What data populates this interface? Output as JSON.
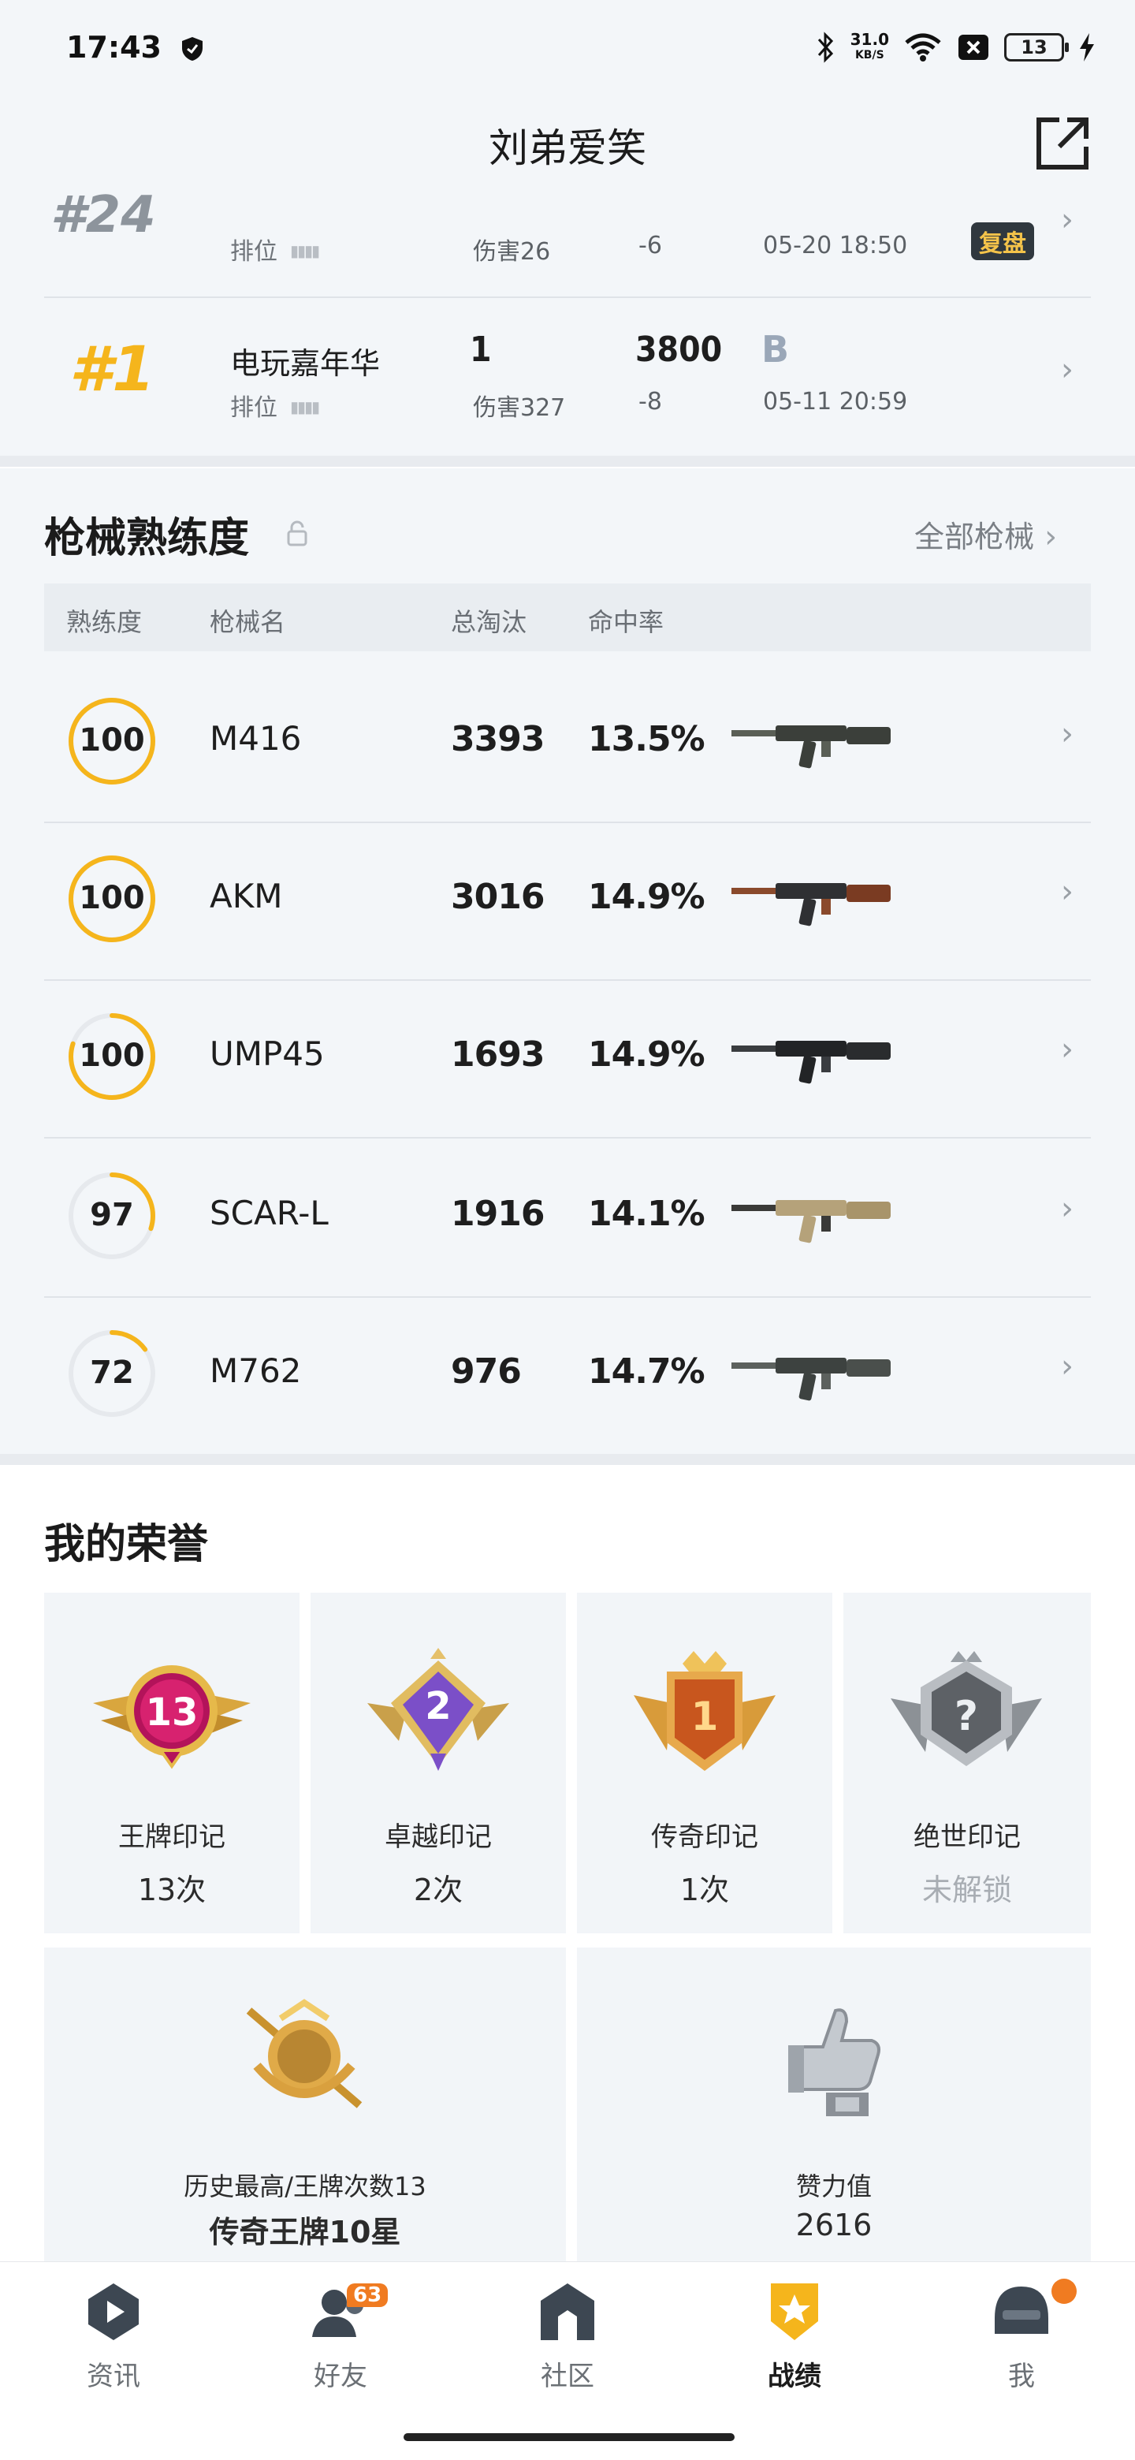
{
  "status_bar": {
    "time": "17:43",
    "net_speed": "31.0",
    "net_unit": "KB/S",
    "battery": "13"
  },
  "header": {
    "title": "刘弟爱笑"
  },
  "matches": [
    {
      "rank": "#24",
      "mode": "",
      "type": "排位",
      "kills": "",
      "score": "",
      "grade": "",
      "damage": "伤害26",
      "change": "-6",
      "time": "05-20 18:50",
      "replay": "复盘"
    },
    {
      "rank": "#1",
      "mode": "电玩嘉年华",
      "type": "排位",
      "kills": "1",
      "score": "3800",
      "grade": "B",
      "damage": "伤害327",
      "change": "-8",
      "time": "05-11 20:59",
      "replay": ""
    }
  ],
  "weapons": {
    "title": "枪械熟练度",
    "all_link": "全部枪械",
    "headers": [
      "熟练度",
      "枪械名",
      "总淘汰",
      "命中率"
    ],
    "rows": [
      {
        "level": "100",
        "progress": 1.0,
        "name": "M416",
        "kills": "3393",
        "hit_rate": "13.5%",
        "icon": "m416-rifle-icon"
      },
      {
        "level": "100",
        "progress": 1.0,
        "name": "AKM",
        "kills": "3016",
        "hit_rate": "14.9%",
        "icon": "akm-rifle-icon"
      },
      {
        "level": "100",
        "progress": 0.8,
        "name": "UMP45",
        "kills": "1693",
        "hit_rate": "14.9%",
        "icon": "ump45-smg-icon"
      },
      {
        "level": "97",
        "progress": 0.3,
        "name": "SCAR-L",
        "kills": "1916",
        "hit_rate": "14.1%",
        "icon": "scar-rifle-icon"
      },
      {
        "level": "72",
        "progress": 0.15,
        "name": "M762",
        "kills": "976",
        "hit_rate": "14.7%",
        "icon": "m762-rifle-icon"
      }
    ]
  },
  "honors": {
    "title": "我的荣誉",
    "badges": [
      {
        "label": "王牌印记",
        "value": "13次",
        "badge_text": "13",
        "locked": false
      },
      {
        "label": "卓越印记",
        "value": "2次",
        "badge_text": "2",
        "locked": false
      },
      {
        "label": "传奇印记",
        "value": "1次",
        "badge_text": "1",
        "locked": false
      },
      {
        "label": "绝世印记",
        "value": "未解锁",
        "badge_text": "?",
        "locked": true
      }
    ],
    "big": [
      {
        "label": "历史最高/王牌次数13",
        "value": "传奇王牌10星"
      },
      {
        "label": "赞力值",
        "value": "2616"
      }
    ]
  },
  "tabs": [
    {
      "label": "资讯",
      "icon": "news-play-icon",
      "active": false
    },
    {
      "label": "好友",
      "icon": "friends-icon",
      "active": false,
      "badge": "63"
    },
    {
      "label": "社区",
      "icon": "community-house-icon",
      "active": false
    },
    {
      "label": "战绩",
      "icon": "record-shield-icon",
      "active": true
    },
    {
      "label": "我",
      "icon": "helmet-avatar-icon",
      "active": false
    }
  ],
  "colors": {
    "accent": "#f5b51c",
    "bg": "#f3f6f9",
    "badge_orange": "#f07b21"
  }
}
